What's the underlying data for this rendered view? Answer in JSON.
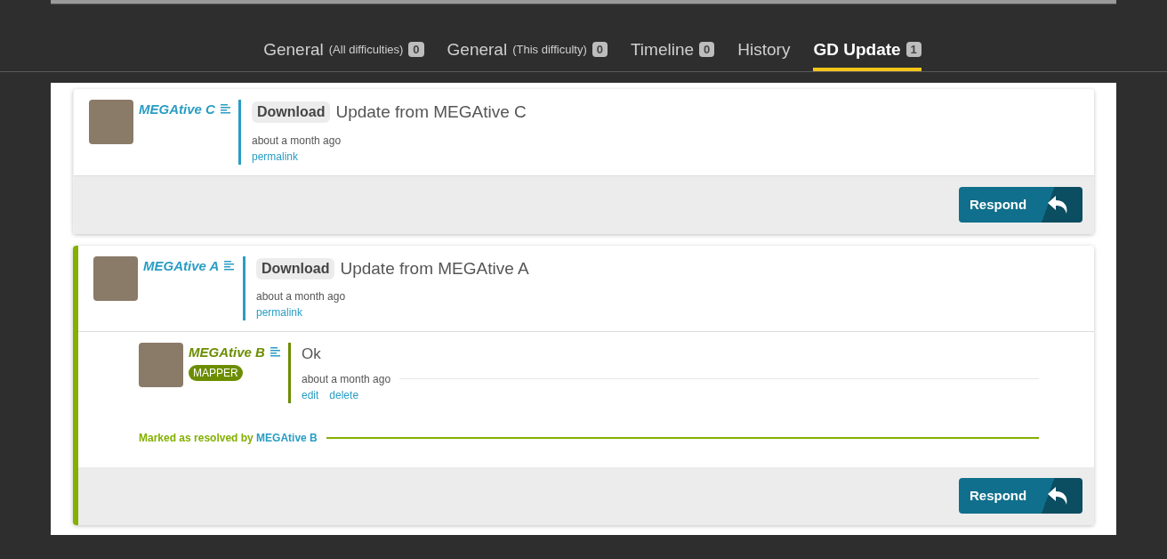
{
  "tabs": [
    {
      "label": "General",
      "note": "(All difficulties)",
      "count": "0",
      "selected": false
    },
    {
      "label": "General",
      "note": "(This difficulty)",
      "count": "0",
      "selected": false
    },
    {
      "label": "Timeline",
      "count": "0",
      "selected": false
    },
    {
      "label": "History",
      "selected": false
    },
    {
      "label": "GD Update",
      "count": "1",
      "selected": true
    }
  ],
  "discussions": [
    {
      "author": "MEGAtive C",
      "tag": "Download",
      "message": "Update from MEGAtive C",
      "time": "about a month ago",
      "link": "permalink",
      "resolved": false,
      "button": "Respond"
    },
    {
      "author": "MEGAtive A",
      "tag": "Download",
      "message": "Update from MEGAtive A",
      "time": "about a month ago",
      "link": "permalink",
      "resolved": true,
      "replies": [
        {
          "author": "MEGAtive B",
          "badge": "MAPPER",
          "message": "Ok",
          "time": "about a month ago",
          "actions": [
            "edit",
            "delete"
          ]
        }
      ],
      "resolution": {
        "text": "Marked as resolved by",
        "user": "MEGAtive B"
      },
      "button": "Respond"
    }
  ]
}
